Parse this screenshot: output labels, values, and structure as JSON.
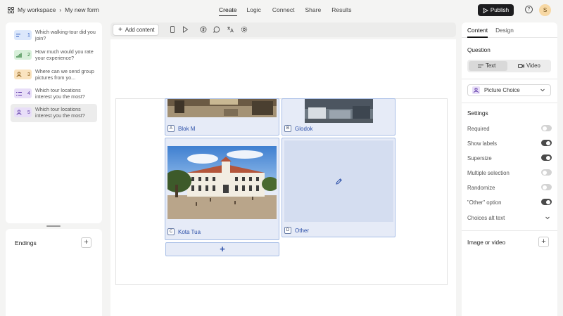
{
  "breadcrumb": {
    "workspace": "My workspace",
    "separator": "›",
    "form": "My new form"
  },
  "nav_tabs": {
    "create": "Create",
    "logic": "Logic",
    "connect": "Connect",
    "share": "Share",
    "results": "Results",
    "active": "Create"
  },
  "header": {
    "publish_label": "Publish",
    "help_label": "?",
    "avatar_initial": "S"
  },
  "questions": [
    {
      "number": "1",
      "text": "Which walking-tour did you join?",
      "icon": "short-text-icon",
      "color": "#dbe7fb"
    },
    {
      "number": "2",
      "text": "How much would you rate your experience?",
      "icon": "rating-bars-icon",
      "color": "#d8f0da"
    },
    {
      "number": "3",
      "text": "Where can we send group pictures from yo...",
      "icon": "contact-info-icon",
      "color": "#fae3bf"
    },
    {
      "number": "4",
      "text": "Which tour locations interest you the most?",
      "icon": "multiple-choice-icon",
      "color": "#e8def8"
    },
    {
      "number": "5",
      "text": "Which tour locations interest you the most?",
      "icon": "picture-choice-icon",
      "color": "#e8def8",
      "selected": true
    }
  ],
  "endings": {
    "label": "Endings",
    "add_label": "+"
  },
  "toolbar": {
    "add_content_label": "Add content",
    "add_content_icon": "+"
  },
  "choices": [
    {
      "letter": "A",
      "label": "Blok M"
    },
    {
      "letter": "B",
      "label": "Glodok"
    },
    {
      "letter": "C",
      "label": "Kota Tua"
    },
    {
      "letter": "D",
      "label": "Other"
    }
  ],
  "add_choice_label": "+",
  "right_panel": {
    "tabs": {
      "content": "Content",
      "design": "Design",
      "active": "Content"
    },
    "question_label": "Question",
    "segment": {
      "text": "Text",
      "video": "Video",
      "selected": "Text"
    },
    "question_type": "Picture Choice",
    "settings_label": "Settings",
    "settings": [
      {
        "label": "Required",
        "on": false
      },
      {
        "label": "Show labels",
        "on": true
      },
      {
        "label": "Supersize",
        "on": true
      },
      {
        "label": "Multiple selection",
        "on": false
      },
      {
        "label": "Randomize",
        "on": false
      },
      {
        "label": "\"Other\" option",
        "on": true
      }
    ],
    "choices_alt_text": "Choices alt text",
    "image_or_video": "Image or video",
    "media_add_label": "+"
  },
  "colors": {
    "accent_blue": "#2c4fa8",
    "choice_fill": "#e6ebf7",
    "choice_border": "#a6bde6",
    "publish_bg": "#1d1d1f"
  }
}
